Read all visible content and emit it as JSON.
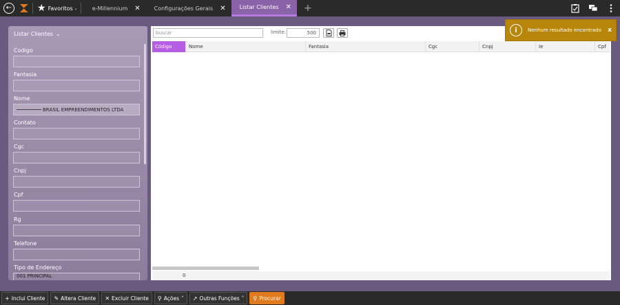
{
  "topbar": {
    "favorites_label": "Favoritos",
    "tabs": [
      {
        "label": "e-Millennium",
        "active": false
      },
      {
        "label": "Configurações Gerais",
        "active": false
      },
      {
        "label": "Listar Clientes",
        "active": true
      }
    ],
    "icons": [
      "back-arrow-icon",
      "app-logo-icon",
      "star-icon",
      "clipboard-check-icon",
      "chat-icon",
      "kebab-menu-icon"
    ]
  },
  "filter_panel": {
    "title": "Listar Clientes",
    "fields": [
      {
        "label": "Codigo",
        "value": ""
      },
      {
        "label": "Fantasia",
        "value": ""
      },
      {
        "label": "Nome",
        "value": "BRASIL EMPREENDIMENTOS LTDA"
      },
      {
        "label": "Contato",
        "value": ""
      },
      {
        "label": "Cgc",
        "value": ""
      },
      {
        "label": "Cnpj",
        "value": ""
      },
      {
        "label": "Cpf",
        "value": ""
      },
      {
        "label": "Rg",
        "value": ""
      },
      {
        "label": "Telefone",
        "value": ""
      },
      {
        "label": "Tipo de Endereço",
        "value": "001 PRINCIPAL"
      }
    ]
  },
  "grid": {
    "search_placeholder": "buscar",
    "limite_label": "limite:",
    "limite_value": "500",
    "columns": [
      "Código",
      "Nome",
      "Fantasia",
      "Cgc",
      "Cnpj",
      "Ie",
      "Cpf"
    ],
    "count": "0"
  },
  "toast": {
    "message": "Nenhum resultado encontrado",
    "close": "x",
    "color": "#b8860b"
  },
  "bottombar": {
    "buttons": [
      {
        "label": "Inclui Cliente",
        "icon": "plus-icon"
      },
      {
        "label": "Altera Cliente",
        "icon": "edit-icon"
      },
      {
        "label": "Excluir Cliente",
        "icon": "times-icon"
      },
      {
        "label": "Ações",
        "icon": "pin-icon"
      },
      {
        "label": "Outras Funções",
        "icon": "external-icon"
      },
      {
        "label": "Procurar",
        "icon": "search-icon"
      }
    ]
  },
  "colors": {
    "accent": "#b65ee3",
    "active_tab": "#8a62a8",
    "primary_button": "#e07a1f"
  }
}
